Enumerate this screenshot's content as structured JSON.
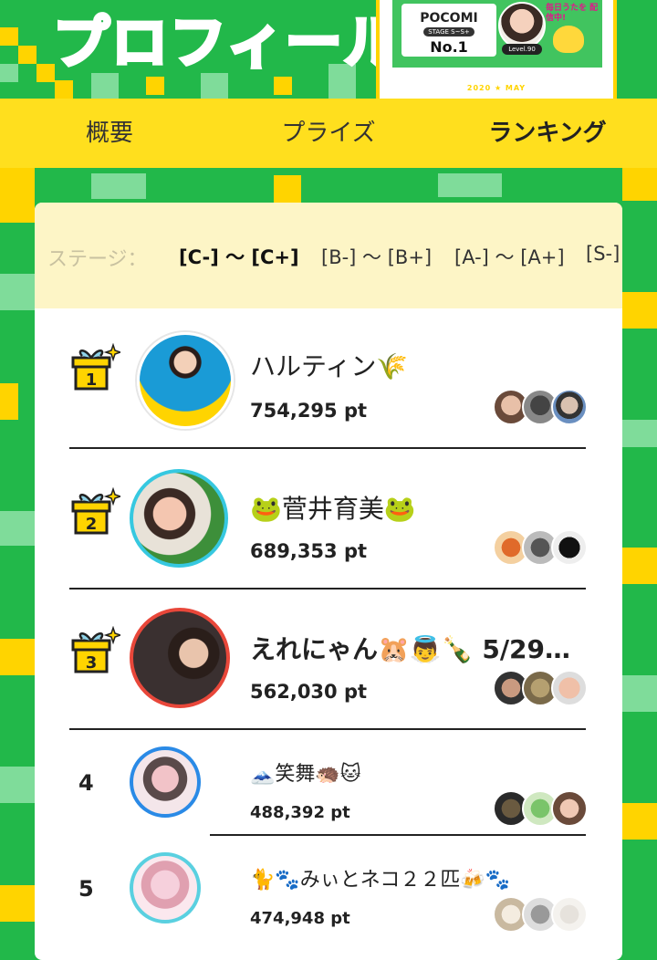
{
  "banner": {
    "title": "プロフィール",
    "card": {
      "logo": "POCOMI",
      "stage": "STAGE S~S+",
      "rank": "No.1",
      "level": "Level.90",
      "daily": "毎日うたを 配信中!",
      "footer": "2020 ★ MAY"
    }
  },
  "tabs": [
    {
      "label": "概要",
      "active": false
    },
    {
      "label": "プライズ",
      "active": false
    },
    {
      "label": "ランキング",
      "active": true
    }
  ],
  "stage_filter": {
    "label": "ステージ：",
    "options": [
      {
        "label": "[C-] 〜 [C+]",
        "active": true
      },
      {
        "label": "[B-] 〜 [B+]",
        "active": false
      },
      {
        "label": "[A-] 〜 [A+]",
        "active": false
      },
      {
        "label": "[S-]",
        "active": false
      }
    ]
  },
  "ranking": [
    {
      "rank": "1",
      "name": "ハルティン🌾",
      "points": "754,295 pt",
      "ring": "#ffffff",
      "avatar_colors": [
        "#1a9bd6",
        "#ffd400"
      ]
    },
    {
      "rank": "2",
      "name": "🐸菅井育美🐸",
      "points": "689,353 pt",
      "ring": "#36c8e0",
      "avatar_colors": [
        "#f4c6b0",
        "#3d8f3a"
      ]
    },
    {
      "rank": "3",
      "name": "えれにゃん🐹👼🍾 5/29…",
      "points": "562,030 pt",
      "ring": "#e8473a",
      "avatar_colors": [
        "#3a2f2a",
        "#d9b59a"
      ]
    },
    {
      "rank": "4",
      "name": "🗻笑舞🦔🐱",
      "points": "488,392 pt",
      "ring": "#2a8ae6",
      "avatar_colors": [
        "#f2c3c8",
        "#5a4a4a"
      ]
    },
    {
      "rank": "5",
      "name": "🐈🐾みぃとネコ２２匹🍻🐾",
      "points": "474,948 pt",
      "ring": "#5ad0e0",
      "avatar_colors": [
        "#f6d0dc",
        "#e0a0b0"
      ]
    }
  ],
  "colors": {
    "background_green": "#22b84a",
    "accent_yellow": "#ffdf1e",
    "stage_bar": "#fdf5c6",
    "title_pink": "#ff5ac8"
  }
}
